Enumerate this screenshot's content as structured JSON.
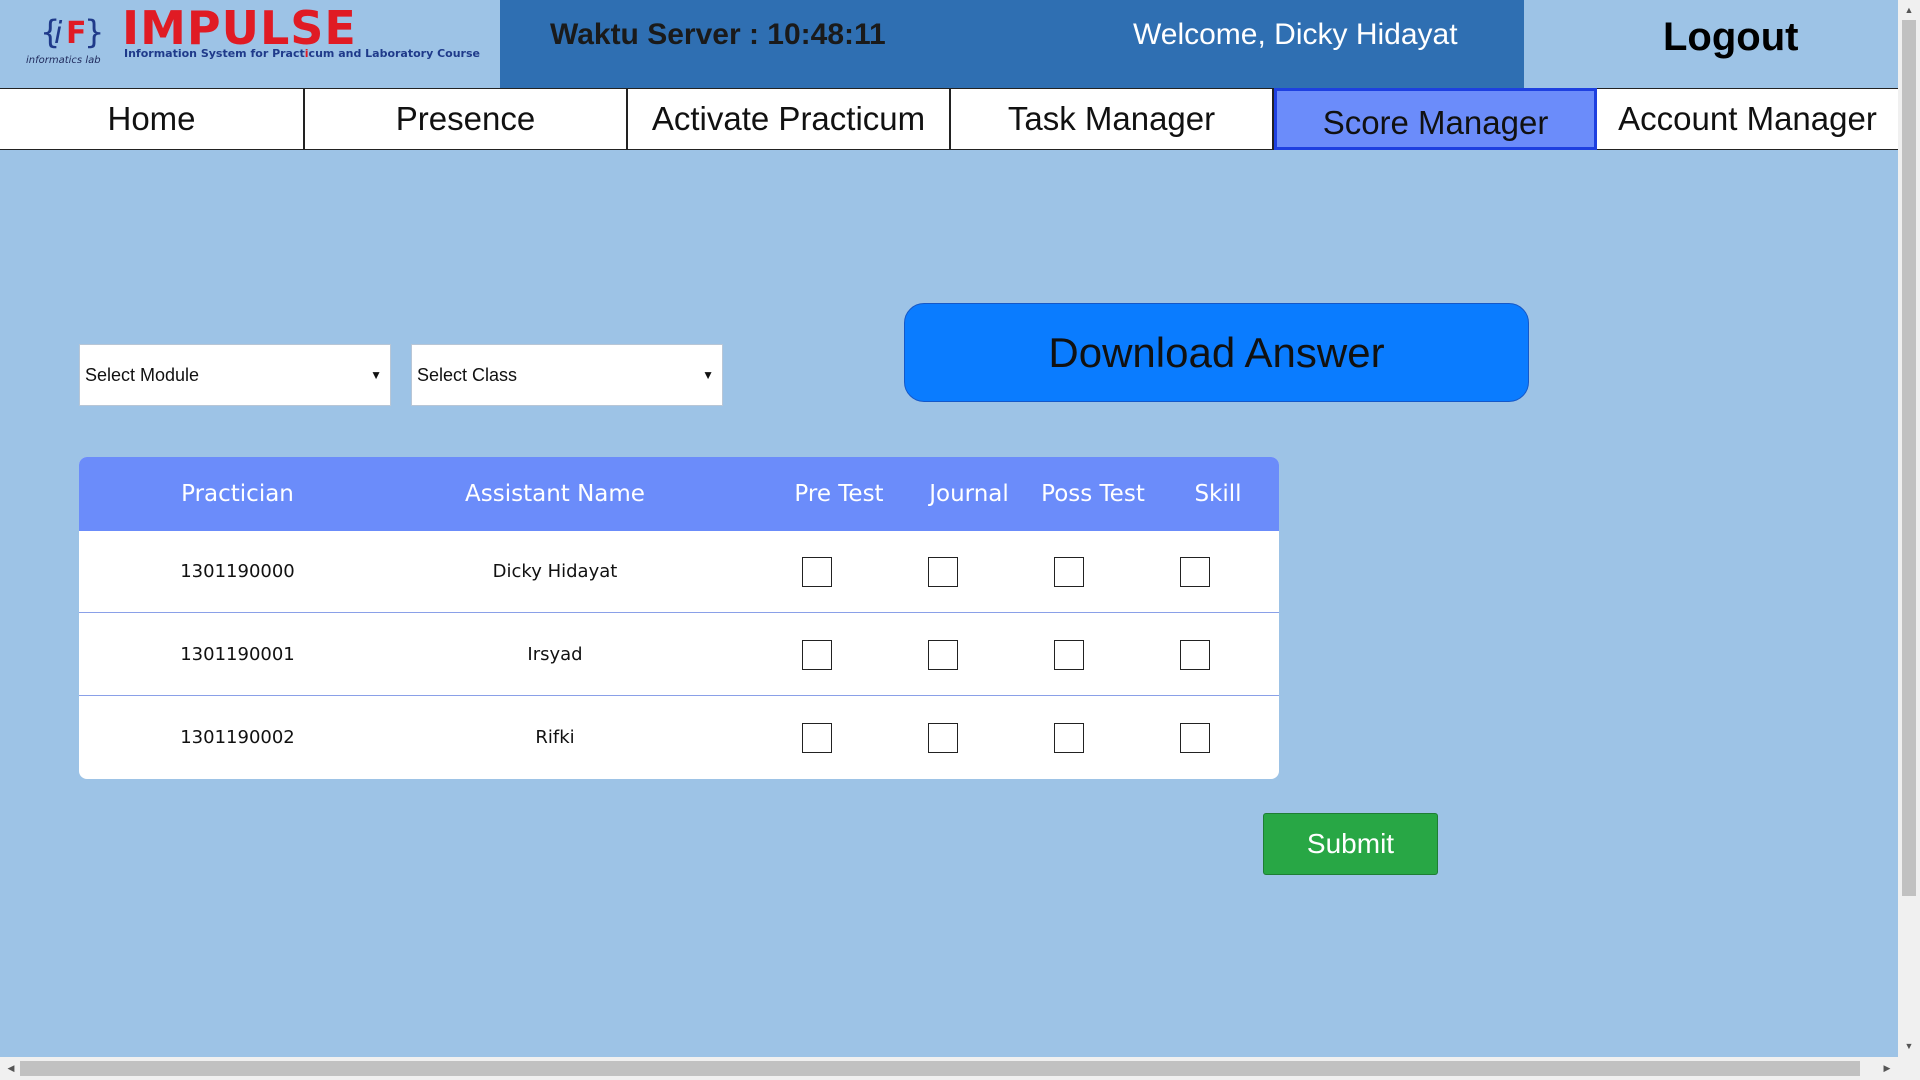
{
  "brand": {
    "mark": "{iF}",
    "subtitle": "informatics lab",
    "title": "IMPULSE",
    "tagline_parts": [
      "Information System for Pract",
      "i",
      "cum and Laboratory Course"
    ]
  },
  "header": {
    "server_time": "Waktu Server : 10:48:11",
    "welcome": "Welcome, Dicky Hidayat",
    "logout": "Logout"
  },
  "nav": {
    "items": [
      "Home",
      "Presence",
      "Activate Practicum",
      "Task Manager",
      "Score Manager",
      "Account Manager"
    ],
    "active": "Score Manager"
  },
  "filters": {
    "module": "Select Module",
    "class": "Select Class",
    "arrow": "▼"
  },
  "download_button": "Download Answer",
  "table": {
    "headers": [
      "Practician",
      "Assistant Name",
      "Pre Test",
      "Journal",
      "Poss Test",
      "Skill"
    ],
    "rows": [
      {
        "practician": "1301190000",
        "assistant": "Dicky Hidayat"
      },
      {
        "practician": "1301190001",
        "assistant": "Irsyad"
      },
      {
        "practician": "1301190002",
        "assistant": "Rifki"
      }
    ]
  },
  "submit_button": "Submit",
  "colors": {
    "page_bg": "#9dc3e6",
    "server_bar": "#2f6fb2",
    "active_tab": "#6b8cfa",
    "download": "#0a7cff",
    "table_header": "#6b8cfa",
    "submit": "#28a745"
  }
}
